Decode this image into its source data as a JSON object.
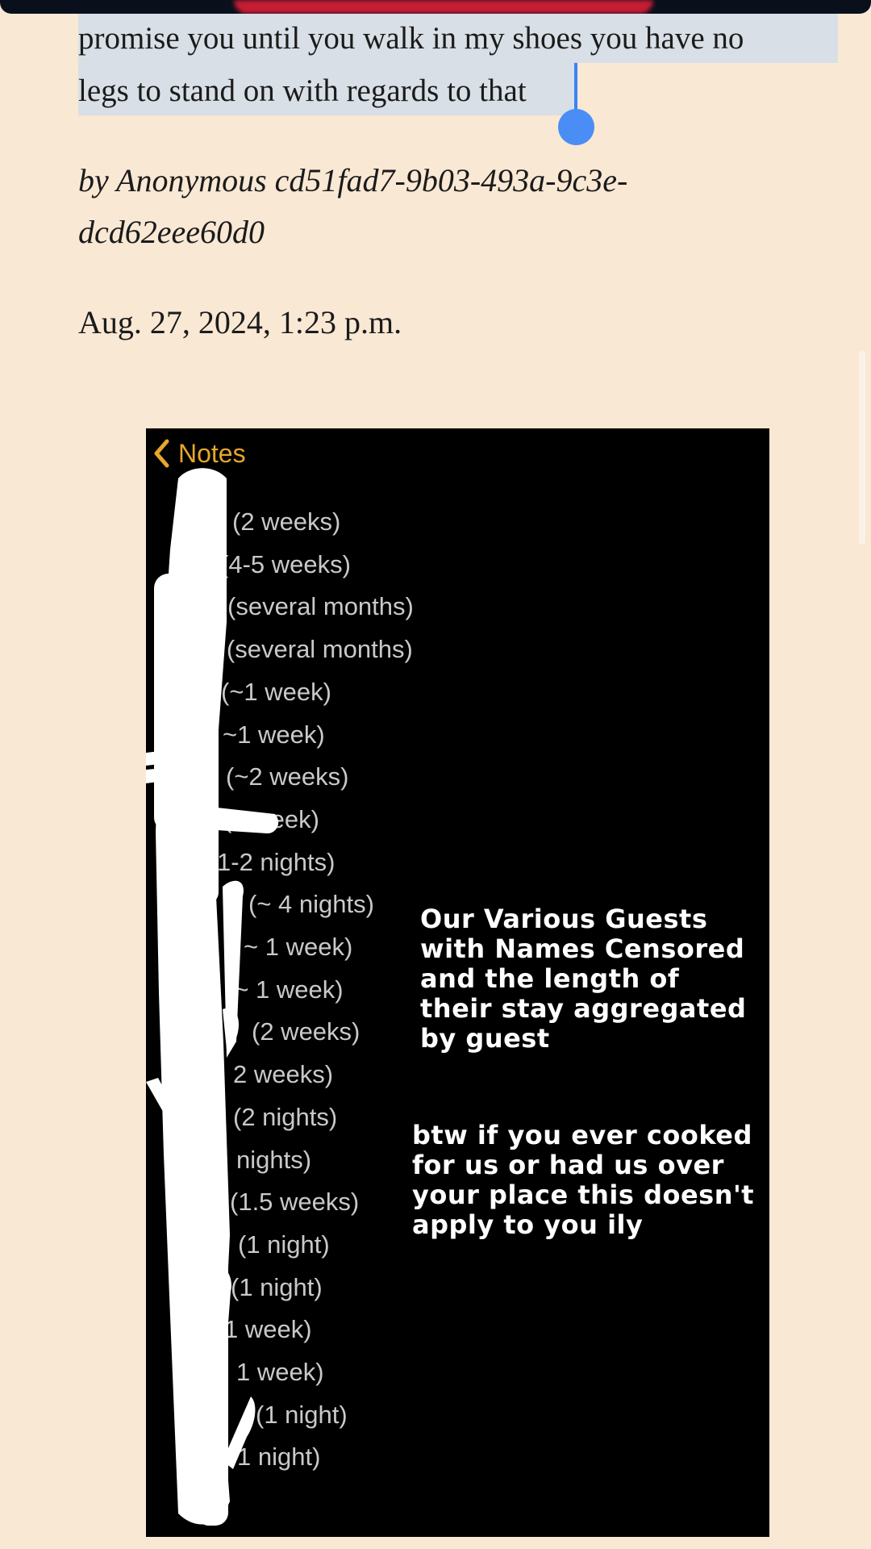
{
  "post": {
    "line1": "promise you until you walk in my shoes you have no",
    "line2": "legs to stand on with regards to that",
    "byline_line1": "by Anonymous cd51fad7-9b03-493a-9c3e-",
    "byline_line2": "dcd62eee60d0",
    "date": "Aug. 27, 2024, 1:23 p.m."
  },
  "screenshot": {
    "back_label": "Notes",
    "entries": [
      "(2 weeks)",
      "(4-5 weeks)",
      "(several months)",
      "r (several months)",
      "(~1 week)",
      "~1 week)",
      "(~2 weeks)",
      "y (1 week)",
      "1-2 nights)",
      "(~ 4 nights)",
      "~ 1 week)",
      "(~ 1 week)",
      "(2 weeks)",
      "2 weeks)",
      "(2 nights)",
      "nights)",
      "(1.5 weeks)",
      "(1 night)",
      "(1 night)",
      "1 week)",
      "1 week)",
      "(1 night)",
      "1 night)"
    ],
    "caption1": [
      "Our Various Guests",
      "with Names Censored",
      "and the length of",
      "their stay aggregated",
      "by guest"
    ],
    "caption2": [
      "btw if you ever cooked",
      "for us or had us over",
      "your place this doesn't",
      "apply to you ily"
    ]
  },
  "colors": {
    "page_background": "#f9e8d4",
    "selection": "#d8dfe6",
    "caret": "#3b82f6",
    "notes_accent": "#e5a72a"
  }
}
